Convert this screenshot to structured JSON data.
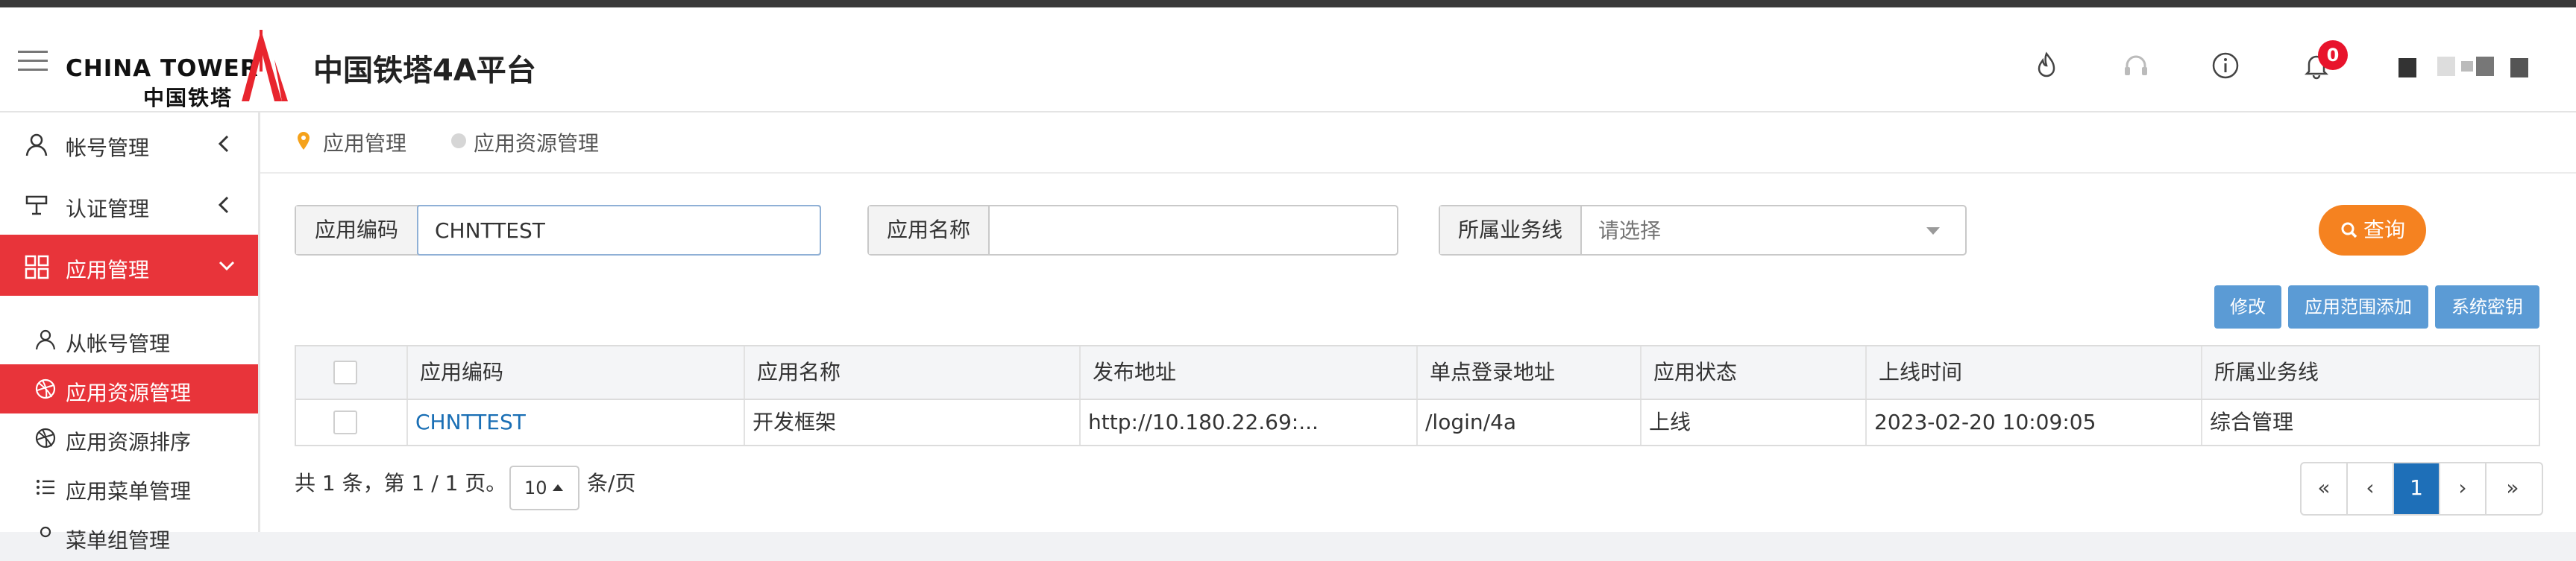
{
  "header": {
    "logo_en": "CHINA TOWER",
    "logo_cn": "中国铁塔",
    "app_title": "中国铁塔4A平台",
    "notification_count": "0"
  },
  "sidebar": {
    "items": [
      {
        "label": "帐号管理",
        "icon": "user-icon"
      },
      {
        "label": "认证管理",
        "icon": "stamp-icon"
      },
      {
        "label": "应用管理",
        "icon": "grid-icon",
        "active": true
      }
    ],
    "subitems": [
      {
        "label": "从帐号管理",
        "icon": "user-icon"
      },
      {
        "label": "应用资源管理",
        "icon": "dribbble-icon",
        "active": true
      },
      {
        "label": "应用资源排序",
        "icon": "dribbble-icon"
      },
      {
        "label": "应用菜单管理",
        "icon": "list-icon"
      },
      {
        "label": "菜单组管理",
        "icon": "user-icon"
      }
    ]
  },
  "breadcrumb": {
    "parent": "应用管理",
    "current": "应用资源管理"
  },
  "filters": {
    "code_label": "应用编码",
    "code_value": "CHNTTEST",
    "name_label": "应用名称",
    "name_value": "",
    "biz_label": "所属业务线",
    "biz_placeholder": "请选择",
    "query_label": "查询"
  },
  "actions": {
    "edit": "修改",
    "add_scope": "应用范围添加",
    "secret": "系统密钥"
  },
  "table": {
    "headers": [
      "应用编码",
      "应用名称",
      "发布地址",
      "单点登录地址",
      "应用状态",
      "上线时间",
      "所属业务线"
    ],
    "rows": [
      [
        "CHNTTEST",
        "开发框架",
        "http://10.180.22.69:...",
        "/login/4a",
        "上线",
        "2023-02-20 10:09:05",
        "综合管理"
      ]
    ]
  },
  "pagination": {
    "summary": "共 1 条，第 1 / 1 页。",
    "page_size": "10",
    "page_size_suffix": "条/页",
    "first": "«",
    "prev": "‹",
    "current": "1",
    "next": "›",
    "last": "»"
  },
  "colors": {
    "accent_red": "#e8343a",
    "query_orange": "#f58220",
    "button_blue": "#5b9bd5",
    "pager_blue": "#1e6fb8"
  }
}
